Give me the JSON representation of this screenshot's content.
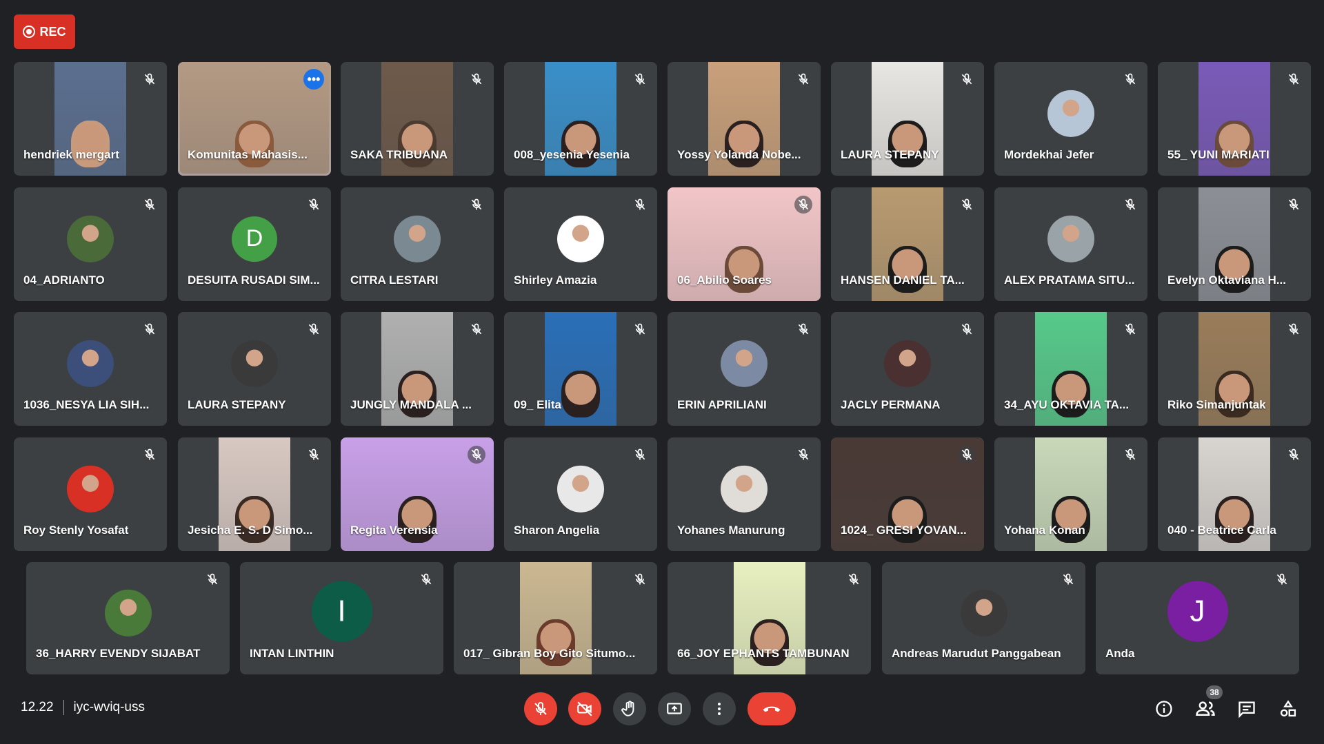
{
  "rec": {
    "label": "REC"
  },
  "meeting": {
    "time": "12.22",
    "code": "iyc-wviq-uss",
    "participant_count": "38"
  },
  "colors": {
    "background": "#202124",
    "tile": "#3c4043",
    "rec": "#d93025",
    "end_call": "#ea4335",
    "active_outline": "#8ab4f8"
  },
  "participants": [
    {
      "name": "hendriek mergart"
    },
    {
      "name": "Komunitas Mahasis..."
    },
    {
      "name": "SAKA TRIBUANA"
    },
    {
      "name": "008_yesenia Yesenia"
    },
    {
      "name": "Yossy Yolanda Nobe..."
    },
    {
      "name": "LAURA STEPANY"
    },
    {
      "name": "Mordekhai Jefer"
    },
    {
      "name": "55_ YUNI MARIATI"
    },
    {
      "name": "04_ADRIANTO"
    },
    {
      "name": "DESUITA RUSADI SIM...",
      "initial": "D"
    },
    {
      "name": "CITRA LESTARI"
    },
    {
      "name": "Shirley Amazia"
    },
    {
      "name": "06_Abilio Soares"
    },
    {
      "name": "HANSEN DANIEL TA..."
    },
    {
      "name": "ALEX PRATAMA SITU..."
    },
    {
      "name": "Evelyn Oktaviana H..."
    },
    {
      "name": "1036_NESYA LIA SIH..."
    },
    {
      "name": "LAURA STEPANY"
    },
    {
      "name": "JUNGLY MANDALA ..."
    },
    {
      "name": "09_ Elita"
    },
    {
      "name": "ERIN APRILIANI"
    },
    {
      "name": "JACLY PERMANA"
    },
    {
      "name": "34_AYU OKTAVIA TA..."
    },
    {
      "name": "Riko Simanjuntak"
    },
    {
      "name": "Roy Stenly Yosafat"
    },
    {
      "name": "Jesicha E. S. D Simo..."
    },
    {
      "name": "Regita Verensia"
    },
    {
      "name": "Sharon Angelia"
    },
    {
      "name": "Yohanes Manurung"
    },
    {
      "name": "1024_ GRESI YOVAN..."
    },
    {
      "name": "Yohana Konan"
    },
    {
      "name": "040 - Beatrice Carla"
    },
    {
      "name": "36_HARRY EVENDY SIJABAT"
    },
    {
      "name": "INTAN LINTHIN",
      "initial": "I"
    },
    {
      "name": "017_ Gibran Boy Gito Situmo..."
    },
    {
      "name": "66_JOY EPHANTS TAMBUNAN"
    },
    {
      "name": "Andreas Marudut Panggabean"
    },
    {
      "name": "Anda",
      "initial": "J"
    }
  ],
  "icons": {
    "mic_off": "mic-off-icon",
    "camera_off": "videocam-off-icon",
    "raise_hand": "raise-hand-icon",
    "present": "present-screen-icon",
    "more": "more-vert-icon",
    "end_call": "call-end-icon",
    "info": "info-icon",
    "people": "people-icon",
    "chat": "chat-icon",
    "activities": "activities-icon"
  }
}
